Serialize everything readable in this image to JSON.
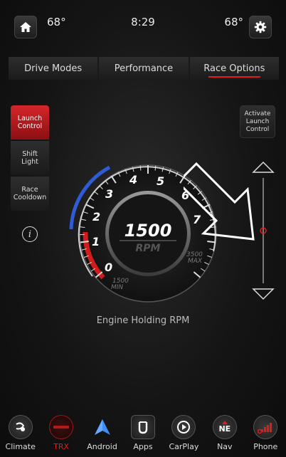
{
  "status": {
    "temp_left": "68°",
    "time": "8:29",
    "temp_right": "68°"
  },
  "tabs": [
    {
      "label": "Drive Modes"
    },
    {
      "label": "Performance"
    },
    {
      "label": "Race Options",
      "active": true
    }
  ],
  "side_buttons": [
    {
      "label": "Launch\nControl",
      "active": true
    },
    {
      "label": "Shift\nLight"
    },
    {
      "label": "Race\nCooldown"
    }
  ],
  "launch_button": "Activate\nLaunch\nControl",
  "gauge": {
    "value": "1500",
    "unit": "RPM",
    "ticks": [
      "0",
      "1",
      "2",
      "3",
      "4",
      "5",
      "6",
      "7"
    ],
    "min_label_value": "1500",
    "min_label_text": "MIN",
    "max_label_value": "3500",
    "max_label_text": "MAX",
    "caption": "Engine Holding RPM",
    "slider_level": 0.5
  },
  "dock": [
    {
      "label": "Climate",
      "icon": "climate-icon"
    },
    {
      "label": "TRX",
      "icon": "trx-icon",
      "active": true
    },
    {
      "label": "Android",
      "icon": "android-auto-icon"
    },
    {
      "label": "Apps",
      "icon": "apps-icon"
    },
    {
      "label": "CarPlay",
      "icon": "carplay-icon"
    },
    {
      "label": "Nav",
      "icon": "nav-icon",
      "badge": "NE"
    },
    {
      "label": "Phone",
      "icon": "phone-icon"
    }
  ],
  "colors": {
    "accent": "#e21b1b",
    "blue_arc": "#2f5bd6"
  }
}
